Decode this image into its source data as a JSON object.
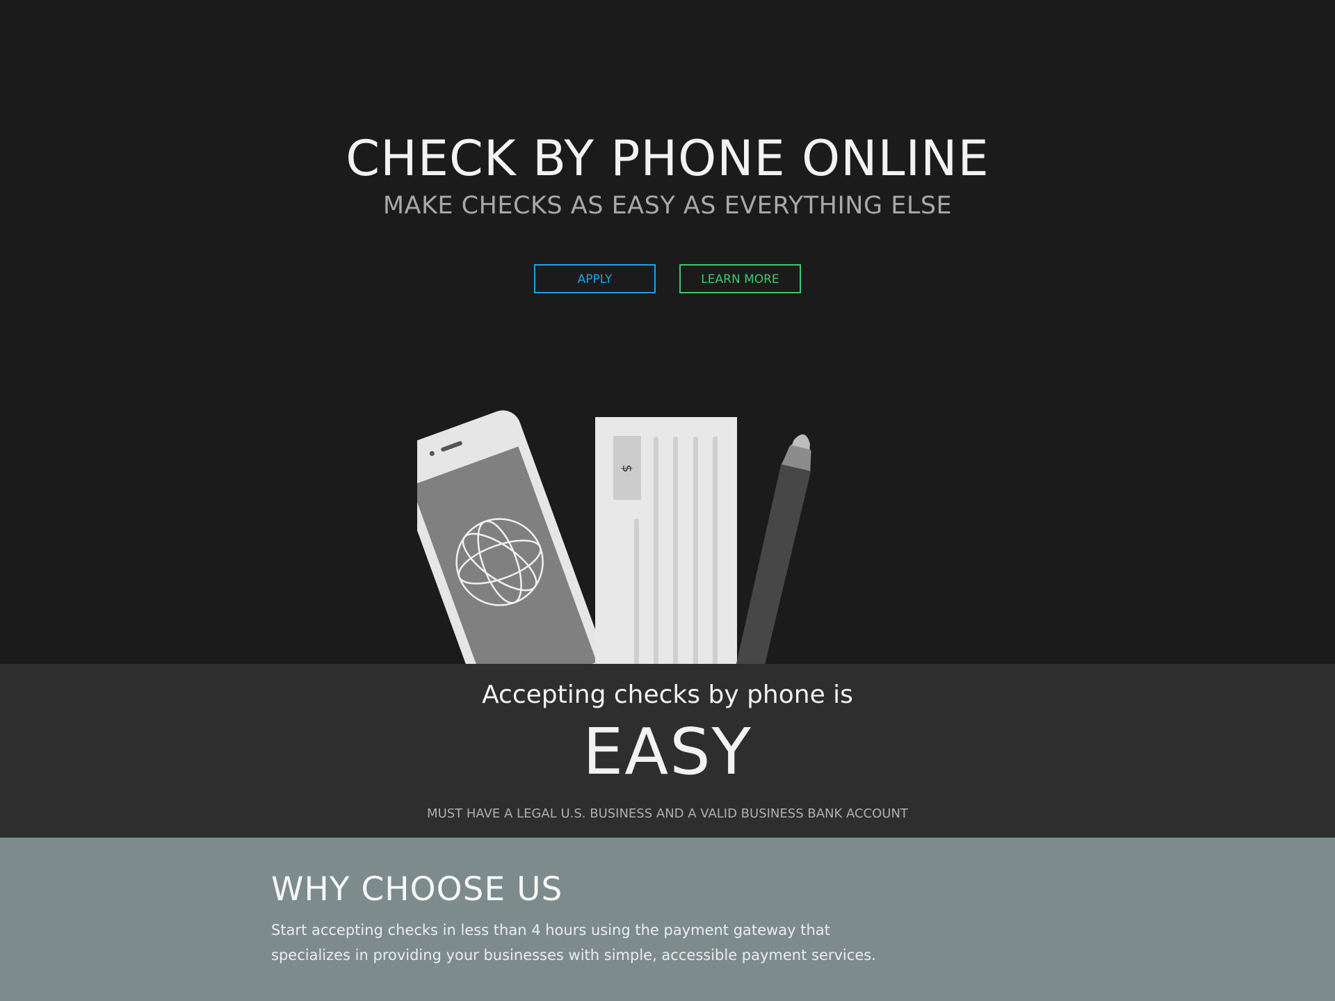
{
  "hero": {
    "title": "CHECK BY PHONE ONLINE",
    "subtitle": "MAKE CHECKS AS EASY AS EVERYTHING ELSE",
    "apply_label": "APPLY",
    "learn_more_label": "LEARN MORE",
    "illustration": {
      "phone_icon": "smartphone-icon",
      "globe_icon": "globe-icon",
      "check_icon": "check-document-icon",
      "pen_icon": "pen-icon",
      "dollar_symbol": "$"
    }
  },
  "easy": {
    "lead": "Accepting checks by phone is",
    "word": "EASY",
    "note": "MUST HAVE A LEGAL U.S. BUSINESS AND A VALID BUSINESS BANK ACCOUNT"
  },
  "why": {
    "title": "WHY CHOOSE US",
    "text": "Start accepting checks in less than 4 hours using the payment gateway that specializes in providing your businesses with simple, accessible payment services."
  },
  "colors": {
    "hero_bg": "#1b1b1b",
    "easy_bg": "#2e2e2e",
    "why_bg": "#7e8b8d",
    "apply_accent": "#1aa3e6",
    "learn_more_accent": "#3cc96e"
  }
}
